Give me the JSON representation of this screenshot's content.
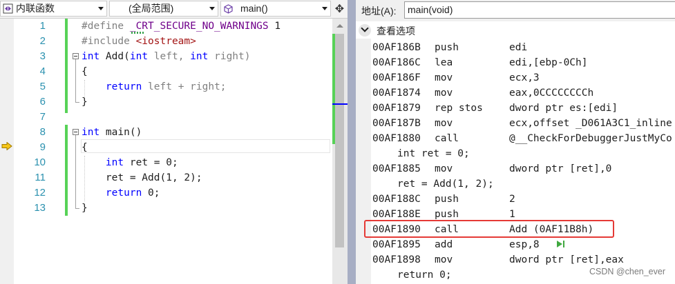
{
  "editor": {
    "nav": {
      "scope_combo": "内联函数",
      "range_combo": "(全局范围)",
      "member_combo": "main()"
    },
    "line_numbers": [
      "1",
      "2",
      "3",
      "4",
      "5",
      "6",
      "7",
      "8",
      "9",
      "10",
      "11",
      "12",
      "13"
    ],
    "current_line": 9,
    "lines": [
      {
        "tokens": [
          {
            "t": "#define ",
            "c": "pp"
          },
          {
            "t": "_CRT_SECURE_NO_WARNINGS",
            "c": "macro"
          },
          {
            "t": " 1",
            "c": "ident"
          }
        ]
      },
      {
        "tokens": [
          {
            "t": "#include ",
            "c": "pp"
          },
          {
            "t": "<iostream>",
            "c": "str"
          }
        ]
      },
      {
        "tokens": [
          {
            "t": "int",
            "c": "kw"
          },
          {
            "t": " Add(",
            "c": "ident"
          },
          {
            "t": "int",
            "c": "kw"
          },
          {
            "t": " left, ",
            "c": "pp"
          },
          {
            "t": "int",
            "c": "kw"
          },
          {
            "t": " right)",
            "c": "pp"
          }
        ]
      },
      {
        "tokens": [
          {
            "t": "{",
            "c": "ident"
          }
        ]
      },
      {
        "tokens": [
          {
            "t": "    ",
            "c": "ident"
          },
          {
            "t": "return",
            "c": "kw"
          },
          {
            "t": " left + right;",
            "c": "pp"
          }
        ]
      },
      {
        "tokens": [
          {
            "t": "}",
            "c": "ident"
          }
        ]
      },
      {
        "tokens": []
      },
      {
        "tokens": [
          {
            "t": "int",
            "c": "kw"
          },
          {
            "t": " main()",
            "c": "ident"
          }
        ]
      },
      {
        "tokens": [
          {
            "t": "{",
            "c": "ident"
          }
        ]
      },
      {
        "tokens": [
          {
            "t": "    ",
            "c": "ident"
          },
          {
            "t": "int",
            "c": "kw"
          },
          {
            "t": " ret = 0;",
            "c": "ident"
          }
        ]
      },
      {
        "tokens": [
          {
            "t": "    ret = Add(1, 2);",
            "c": "ident"
          }
        ]
      },
      {
        "tokens": [
          {
            "t": "    ",
            "c": "ident"
          },
          {
            "t": "return",
            "c": "kw"
          },
          {
            "t": " 0;",
            "c": "ident"
          }
        ]
      },
      {
        "tokens": [
          {
            "t": "}",
            "c": "ident"
          }
        ]
      }
    ]
  },
  "disassembly": {
    "address_label": "地址(A):",
    "address_value": "main(void)",
    "view_options": "查看选项",
    "rows": [
      {
        "kind": "asm",
        "addr": "00AF186B",
        "mn": "push",
        "op": "edi"
      },
      {
        "kind": "asm",
        "addr": "00AF186C",
        "mn": "lea",
        "op": "edi,[ebp-0Ch]"
      },
      {
        "kind": "asm",
        "addr": "00AF186F",
        "mn": "mov",
        "op": "ecx,3"
      },
      {
        "kind": "asm",
        "addr": "00AF1874",
        "mn": "mov",
        "op": "eax,0CCCCCCCCh"
      },
      {
        "kind": "asm",
        "addr": "00AF1879",
        "mn": "rep stos",
        "op": "dword ptr es:[edi]"
      },
      {
        "kind": "asm",
        "addr": "00AF187B",
        "mn": "mov",
        "op": "ecx,offset _D061A3C1_inline"
      },
      {
        "kind": "asm",
        "addr": "00AF1880",
        "mn": "call",
        "op": "@__CheckForDebuggerJustMyCo"
      },
      {
        "kind": "src",
        "text": "int ret = 0;"
      },
      {
        "kind": "asm",
        "addr": "00AF1885",
        "mn": "mov",
        "op": "dword ptr [ret],0"
      },
      {
        "kind": "src",
        "text": "ret = Add(1, 2);"
      },
      {
        "kind": "asm",
        "addr": "00AF188C",
        "mn": "push",
        "op": "2"
      },
      {
        "kind": "asm",
        "addr": "00AF188E",
        "mn": "push",
        "op": "1"
      },
      {
        "kind": "asm",
        "addr": "00AF1890",
        "mn": "call",
        "op": "Add (0AF11B8h)"
      },
      {
        "kind": "asm",
        "addr": "00AF1895",
        "mn": "add",
        "op": "esp,8"
      },
      {
        "kind": "asm",
        "addr": "00AF1898",
        "mn": "mov",
        "op": "dword ptr [ret],eax"
      },
      {
        "kind": "src",
        "text": "return 0;"
      }
    ],
    "highlighted_addr": "00AF1890"
  },
  "watermark": "CSDN @chen_ever",
  "colors": {
    "accent": "#0000ff",
    "highlight_box": "#e53935",
    "changes_bar": "#57d257"
  }
}
